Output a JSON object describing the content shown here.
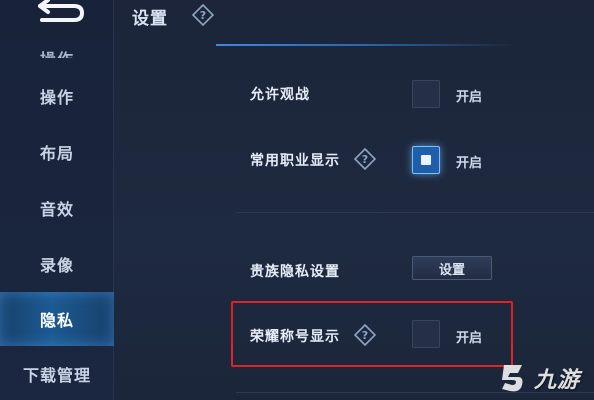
{
  "header": {
    "title": "设置",
    "help_icon": "question-diamond-icon"
  },
  "sidebar": {
    "back_icon": "back-arrow-icon",
    "items": [
      {
        "label": "操作",
        "active": false,
        "partial": true
      },
      {
        "label": "操作",
        "active": false
      },
      {
        "label": "布局",
        "active": false
      },
      {
        "label": "音效",
        "active": false
      },
      {
        "label": "录像",
        "active": false
      },
      {
        "label": "隐私",
        "active": true
      },
      {
        "label": "下载管理",
        "active": false
      }
    ]
  },
  "settings": {
    "allow_spectate": {
      "label": "允许观战",
      "checked": false,
      "toggle_text": "开启"
    },
    "common_role_display": {
      "label": "常用职业显示",
      "checked": true,
      "toggle_text": "开启"
    },
    "noble_privacy": {
      "label": "贵族隐私设置",
      "button_label": "设置"
    },
    "honor_title_display": {
      "label": "荣耀称号显示",
      "checked": false,
      "toggle_text": "开启"
    }
  },
  "watermark": {
    "text": "九游"
  },
  "colors": {
    "accent": "#3d8ae0",
    "active_nav": "#1d5a92",
    "highlight": "#e02424",
    "background": "#1c2539"
  }
}
